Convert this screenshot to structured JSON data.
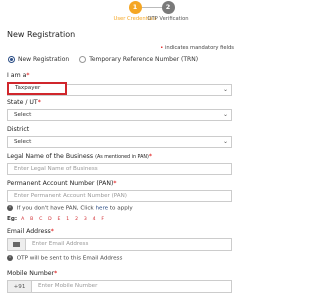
{
  "stepper": {
    "steps": [
      {
        "num": "1",
        "label": "User Credentials"
      },
      {
        "num": "2",
        "label": "OTP Verification"
      }
    ]
  },
  "title": "New Registration",
  "mandatory_note": "indicates mandatory fields",
  "radios": {
    "opt1": "New Registration",
    "opt2": "Temporary Reference Number (TRN)"
  },
  "iam": {
    "label": "I am a",
    "value": "Taxpayer"
  },
  "state": {
    "label": "State / UT",
    "value": "Select"
  },
  "district": {
    "label": "District",
    "value": "Select"
  },
  "legal_name": {
    "label": "Legal Name of the Business",
    "label_small": "(As mentioned in PAN)",
    "placeholder": "Enter Legal Name of Business"
  },
  "pan": {
    "label": "Permanent Account Number (PAN)",
    "placeholder": "Enter Permanent Account Number (PAN)",
    "info_prefix": "If you don't have PAN, Click",
    "info_link": "here",
    "info_suffix": "to apply",
    "eg_label": "Eg:",
    "eg_chars": "A B C D E 1 2 3 4 F"
  },
  "email": {
    "label": "Email Address",
    "placeholder": "Enter Email Address",
    "info": "OTP will be sent to this Email Address"
  },
  "mobile": {
    "label": "Mobile Number",
    "prefix": "+91",
    "placeholder": "Enter Mobile Number"
  },
  "colors": {
    "accent": "#f5a623",
    "highlight": "#d0262c",
    "primary": "#2c4e86"
  }
}
